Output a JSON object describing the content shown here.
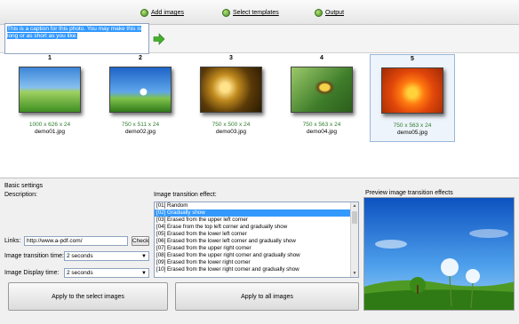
{
  "steps": [
    {
      "label": "Add images"
    },
    {
      "label": "Select templates"
    },
    {
      "label": "Output"
    }
  ],
  "toolbar": {
    "buttons": [
      {
        "icon": "plus-icon"
      },
      {
        "icon": "folder-add-icon"
      },
      {
        "icon": "delete-icon"
      },
      {
        "icon": "delete-all-icon"
      },
      {
        "icon": "arrow-left-icon"
      },
      {
        "icon": "arrow-right-icon"
      }
    ]
  },
  "thumbnails": [
    {
      "num": "1",
      "dims": "1000 x 626 x 24",
      "name": "demo01.jpg",
      "selected": false
    },
    {
      "num": "2",
      "dims": "750 x 511 x 24",
      "name": "demo02.jpg",
      "selected": false
    },
    {
      "num": "3",
      "dims": "750 x 500 x 24",
      "name": "demo03.jpg",
      "selected": false
    },
    {
      "num": "4",
      "dims": "750 x 563 x 24",
      "name": "demo04.jpg",
      "selected": false
    },
    {
      "num": "5",
      "dims": "750 x 563 x 24",
      "name": "demo05.jpg",
      "selected": true
    }
  ],
  "settings": {
    "group_title": "Basic settings",
    "description_label": "Description:",
    "description_value": "This is a caption for this photo. You may make this is long or as short as you like.",
    "links_label": "Links:",
    "links_value": "http://www.a-pdf.com/",
    "check_button": "Check",
    "transition_time_label": "Image transition time:",
    "transition_time_value": "2 seconds",
    "display_time_label": "Image Display time:",
    "display_time_value": "2 seconds",
    "effect_label": "Image transition effect:",
    "effects": [
      {
        "text": "[01] Random",
        "selected": false
      },
      {
        "text": "[02] Gradually show",
        "selected": true
      },
      {
        "text": "[03] Erased from the upper left corner",
        "selected": false
      },
      {
        "text": "[04] Erase from the top left corner and gradually show",
        "selected": false
      },
      {
        "text": "[05] Erased from the lower left corner",
        "selected": false
      },
      {
        "text": "[06] Erased from the lower left corner and gradually show",
        "selected": false
      },
      {
        "text": "[07] Erased from the upper right corner",
        "selected": false
      },
      {
        "text": "[08] Erased from the upper right corner and gradually show",
        "selected": false
      },
      {
        "text": "[09] Erased from the lower right corner",
        "selected": false
      },
      {
        "text": "[10] Erased from the lower right corner and gradually show",
        "selected": false
      }
    ],
    "preview_label": "Preview image transition effects",
    "apply_selected": "Apply to the select images",
    "apply_all": "Apply to all images"
  }
}
